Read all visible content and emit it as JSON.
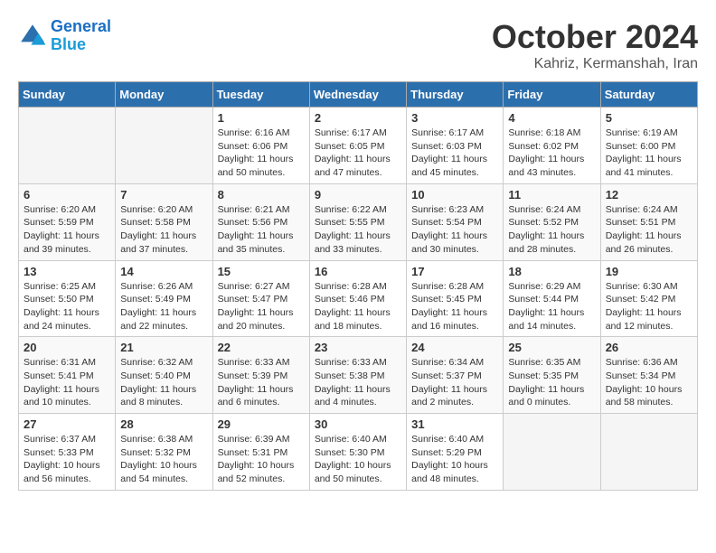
{
  "header": {
    "logo_line1": "General",
    "logo_line2": "Blue",
    "month": "October 2024",
    "location": "Kahriz, Kermanshah, Iran"
  },
  "days_of_week": [
    "Sunday",
    "Monday",
    "Tuesday",
    "Wednesday",
    "Thursday",
    "Friday",
    "Saturday"
  ],
  "weeks": [
    [
      {
        "day": "",
        "sunrise": "",
        "sunset": "",
        "daylight": "",
        "empty": true
      },
      {
        "day": "",
        "sunrise": "",
        "sunset": "",
        "daylight": "",
        "empty": true
      },
      {
        "day": "1",
        "sunrise": "Sunrise: 6:16 AM",
        "sunset": "Sunset: 6:06 PM",
        "daylight": "Daylight: 11 hours and 50 minutes."
      },
      {
        "day": "2",
        "sunrise": "Sunrise: 6:17 AM",
        "sunset": "Sunset: 6:05 PM",
        "daylight": "Daylight: 11 hours and 47 minutes."
      },
      {
        "day": "3",
        "sunrise": "Sunrise: 6:17 AM",
        "sunset": "Sunset: 6:03 PM",
        "daylight": "Daylight: 11 hours and 45 minutes."
      },
      {
        "day": "4",
        "sunrise": "Sunrise: 6:18 AM",
        "sunset": "Sunset: 6:02 PM",
        "daylight": "Daylight: 11 hours and 43 minutes."
      },
      {
        "day": "5",
        "sunrise": "Sunrise: 6:19 AM",
        "sunset": "Sunset: 6:00 PM",
        "daylight": "Daylight: 11 hours and 41 minutes."
      }
    ],
    [
      {
        "day": "6",
        "sunrise": "Sunrise: 6:20 AM",
        "sunset": "Sunset: 5:59 PM",
        "daylight": "Daylight: 11 hours and 39 minutes."
      },
      {
        "day": "7",
        "sunrise": "Sunrise: 6:20 AM",
        "sunset": "Sunset: 5:58 PM",
        "daylight": "Daylight: 11 hours and 37 minutes."
      },
      {
        "day": "8",
        "sunrise": "Sunrise: 6:21 AM",
        "sunset": "Sunset: 5:56 PM",
        "daylight": "Daylight: 11 hours and 35 minutes."
      },
      {
        "day": "9",
        "sunrise": "Sunrise: 6:22 AM",
        "sunset": "Sunset: 5:55 PM",
        "daylight": "Daylight: 11 hours and 33 minutes."
      },
      {
        "day": "10",
        "sunrise": "Sunrise: 6:23 AM",
        "sunset": "Sunset: 5:54 PM",
        "daylight": "Daylight: 11 hours and 30 minutes."
      },
      {
        "day": "11",
        "sunrise": "Sunrise: 6:24 AM",
        "sunset": "Sunset: 5:52 PM",
        "daylight": "Daylight: 11 hours and 28 minutes."
      },
      {
        "day": "12",
        "sunrise": "Sunrise: 6:24 AM",
        "sunset": "Sunset: 5:51 PM",
        "daylight": "Daylight: 11 hours and 26 minutes."
      }
    ],
    [
      {
        "day": "13",
        "sunrise": "Sunrise: 6:25 AM",
        "sunset": "Sunset: 5:50 PM",
        "daylight": "Daylight: 11 hours and 24 minutes."
      },
      {
        "day": "14",
        "sunrise": "Sunrise: 6:26 AM",
        "sunset": "Sunset: 5:49 PM",
        "daylight": "Daylight: 11 hours and 22 minutes."
      },
      {
        "day": "15",
        "sunrise": "Sunrise: 6:27 AM",
        "sunset": "Sunset: 5:47 PM",
        "daylight": "Daylight: 11 hours and 20 minutes."
      },
      {
        "day": "16",
        "sunrise": "Sunrise: 6:28 AM",
        "sunset": "Sunset: 5:46 PM",
        "daylight": "Daylight: 11 hours and 18 minutes."
      },
      {
        "day": "17",
        "sunrise": "Sunrise: 6:28 AM",
        "sunset": "Sunset: 5:45 PM",
        "daylight": "Daylight: 11 hours and 16 minutes."
      },
      {
        "day": "18",
        "sunrise": "Sunrise: 6:29 AM",
        "sunset": "Sunset: 5:44 PM",
        "daylight": "Daylight: 11 hours and 14 minutes."
      },
      {
        "day": "19",
        "sunrise": "Sunrise: 6:30 AM",
        "sunset": "Sunset: 5:42 PM",
        "daylight": "Daylight: 11 hours and 12 minutes."
      }
    ],
    [
      {
        "day": "20",
        "sunrise": "Sunrise: 6:31 AM",
        "sunset": "Sunset: 5:41 PM",
        "daylight": "Daylight: 11 hours and 10 minutes."
      },
      {
        "day": "21",
        "sunrise": "Sunrise: 6:32 AM",
        "sunset": "Sunset: 5:40 PM",
        "daylight": "Daylight: 11 hours and 8 minutes."
      },
      {
        "day": "22",
        "sunrise": "Sunrise: 6:33 AM",
        "sunset": "Sunset: 5:39 PM",
        "daylight": "Daylight: 11 hours and 6 minutes."
      },
      {
        "day": "23",
        "sunrise": "Sunrise: 6:33 AM",
        "sunset": "Sunset: 5:38 PM",
        "daylight": "Daylight: 11 hours and 4 minutes."
      },
      {
        "day": "24",
        "sunrise": "Sunrise: 6:34 AM",
        "sunset": "Sunset: 5:37 PM",
        "daylight": "Daylight: 11 hours and 2 minutes."
      },
      {
        "day": "25",
        "sunrise": "Sunrise: 6:35 AM",
        "sunset": "Sunset: 5:35 PM",
        "daylight": "Daylight: 11 hours and 0 minutes."
      },
      {
        "day": "26",
        "sunrise": "Sunrise: 6:36 AM",
        "sunset": "Sunset: 5:34 PM",
        "daylight": "Daylight: 10 hours and 58 minutes."
      }
    ],
    [
      {
        "day": "27",
        "sunrise": "Sunrise: 6:37 AM",
        "sunset": "Sunset: 5:33 PM",
        "daylight": "Daylight: 10 hours and 56 minutes."
      },
      {
        "day": "28",
        "sunrise": "Sunrise: 6:38 AM",
        "sunset": "Sunset: 5:32 PM",
        "daylight": "Daylight: 10 hours and 54 minutes."
      },
      {
        "day": "29",
        "sunrise": "Sunrise: 6:39 AM",
        "sunset": "Sunset: 5:31 PM",
        "daylight": "Daylight: 10 hours and 52 minutes."
      },
      {
        "day": "30",
        "sunrise": "Sunrise: 6:40 AM",
        "sunset": "Sunset: 5:30 PM",
        "daylight": "Daylight: 10 hours and 50 minutes."
      },
      {
        "day": "31",
        "sunrise": "Sunrise: 6:40 AM",
        "sunset": "Sunset: 5:29 PM",
        "daylight": "Daylight: 10 hours and 48 minutes."
      },
      {
        "day": "",
        "sunrise": "",
        "sunset": "",
        "daylight": "",
        "empty": true
      },
      {
        "day": "",
        "sunrise": "",
        "sunset": "",
        "daylight": "",
        "empty": true
      }
    ]
  ]
}
